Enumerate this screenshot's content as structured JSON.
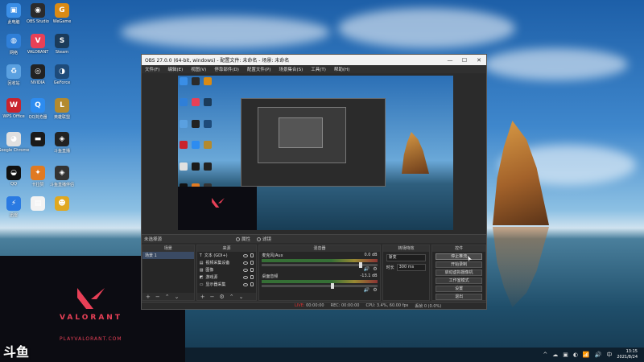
{
  "desktop": {
    "icons": [
      {
        "label": "此电脑",
        "color": "#3a8ee6",
        "glyph": "▣"
      },
      {
        "label": "OBS Studio",
        "color": "#2b2b2b",
        "glyph": "◉"
      },
      {
        "label": "WeGame",
        "color": "#d98a14",
        "glyph": "G"
      },
      {
        "label": "网络",
        "color": "#2f7fd8",
        "glyph": "◍"
      },
      {
        "label": "VALORANT",
        "color": "#e84057",
        "glyph": "V"
      },
      {
        "label": "Steam",
        "color": "#1b3b5a",
        "glyph": "S"
      },
      {
        "label": "回收站",
        "color": "#5aa0e0",
        "glyph": "♻"
      },
      {
        "label": "NVIDIA",
        "color": "#222",
        "glyph": "◎"
      },
      {
        "label": "GeForce",
        "color": "#1e4b7a",
        "glyph": "◑"
      },
      {
        "label": "WPS Office",
        "color": "#c9232d",
        "glyph": "W"
      },
      {
        "label": "QQ浏览器",
        "color": "#2d8cf0",
        "glyph": "Q"
      },
      {
        "label": "英雄联盟",
        "color": "#b38a2e",
        "glyph": "L"
      },
      {
        "label": "Google Chrome",
        "color": "#e0e0e0",
        "glyph": "◕"
      },
      {
        "label": "",
        "color": "#1a1a1a",
        "glyph": "▬"
      },
      {
        "label": "斗鱼直播",
        "color": "#222",
        "glyph": "◈"
      },
      {
        "label": "QQ",
        "color": "#111",
        "glyph": "◒"
      },
      {
        "label": "卡拉赞",
        "color": "#e07a22",
        "glyph": "✦"
      },
      {
        "label": "斗鱼直播伴侣",
        "color": "#333",
        "glyph": "◈"
      },
      {
        "label": "迅雷",
        "color": "#2a7ae2",
        "glyph": "⚡"
      },
      {
        "label": "",
        "color": "#f3f3f3",
        "glyph": "▤"
      },
      {
        "label": "",
        "color": "#e0a820",
        "glyph": "☻"
      }
    ]
  },
  "stream_overlay": {
    "brand_word": "VALORANT",
    "brand_url": "PLAYVALORANT.COM",
    "platform_logo_text": "斗鱼"
  },
  "obs": {
    "title": "OBS 27.0.0 (64-bit, windows) - 配置文件: 未命名 - 场景: 未命名",
    "window_buttons": [
      "—",
      "☐",
      "✕"
    ],
    "menu": [
      "文件(F)",
      "编辑(E)",
      "视图(V)",
      "停靠部件(D)",
      "配置文件(P)",
      "场景集合(S)",
      "工具(T)",
      "帮助(H)"
    ],
    "scene_label": "未选择源",
    "strip_tabs": [
      "属性",
      "滤镜"
    ],
    "docks": {
      "scenes": {
        "header": "场景",
        "items": [
          "场景 1"
        ]
      },
      "sources": {
        "header": "来源",
        "items": [
          {
            "icon": "T",
            "label": "文本 (GDI+)"
          },
          {
            "icon": "▤",
            "label": "视频采集设备"
          },
          {
            "icon": "▨",
            "label": "图像"
          },
          {
            "icon": "◩",
            "label": "游戏源"
          },
          {
            "icon": "▭",
            "label": "显示器采集"
          }
        ]
      },
      "mixer": {
        "header": "混音器",
        "channels": [
          {
            "name": "麦克风/Aux",
            "db": "0.0 dB",
            "level": 0.84
          },
          {
            "name": "桌面音频",
            "db": "-13.1 dB",
            "level": 0.6
          }
        ]
      },
      "transitions": {
        "header": "转场特效",
        "type": "渐变",
        "duration_label": "时长",
        "duration_value": "300 ms"
      },
      "controls": {
        "header": "控件",
        "buttons": [
          "停止推流",
          "开始录制",
          "启动虚拟摄像机",
          "工作室模式",
          "设置",
          "退出"
        ]
      }
    },
    "statusbar": {
      "live_label": "LIVE:",
      "live_time": "00:00:00",
      "rec_label": "REC:",
      "rec_time": "00:00:00",
      "cpu": "CPU: 3.4%, 60.00 fps",
      "dropped": "丢帧 0 (0.0%)"
    }
  },
  "taskbar": {
    "tray_icons": [
      "^",
      "☁",
      "▣",
      "◐",
      "📶",
      "🔊",
      "中"
    ],
    "time": "13:15",
    "date": "2021/8/24"
  }
}
